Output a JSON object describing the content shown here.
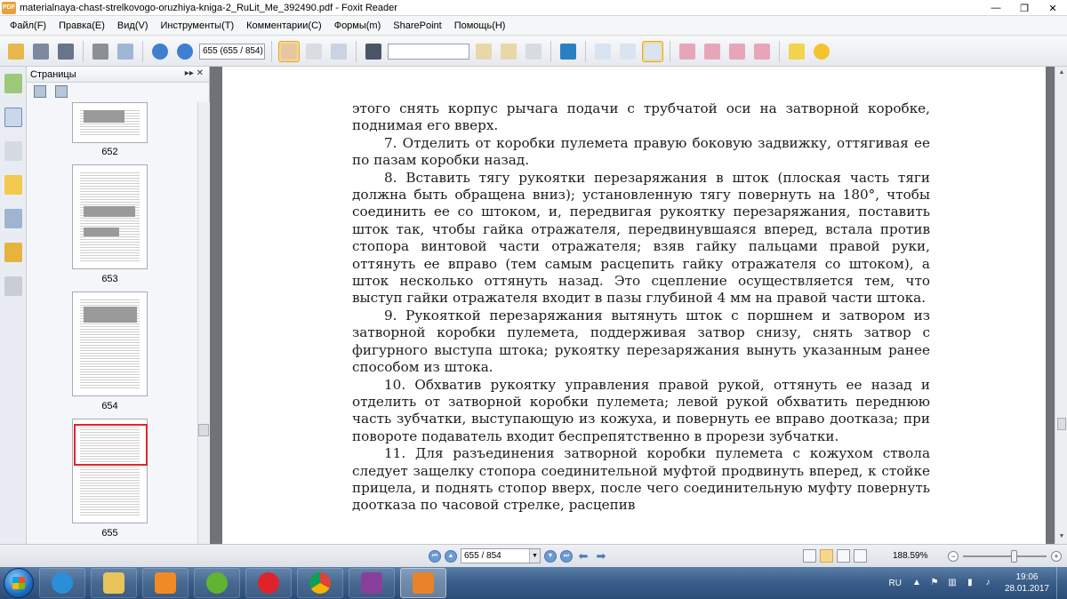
{
  "window": {
    "title": "materialnaya-chast-strelkovogo-oruzhiya-kniga-2_RuLit_Me_392490.pdf - Foxit Reader",
    "app_logo": "PDF",
    "minimize": "—",
    "maximize": "❐",
    "close": "✕"
  },
  "menu": {
    "items": [
      "Файл(F)",
      "Правка(E)",
      "Вид(V)",
      "Инструменты(T)",
      "Комментарии(C)",
      "Формы(m)",
      "SharePoint",
      "Помощь(H)"
    ]
  },
  "toolbar": {
    "page_field": "655 (655 / 854)",
    "search_placeholder": ""
  },
  "sidebar": {
    "title": "Страницы",
    "header_controls": "▸▸  ✕",
    "thumbnails": [
      {
        "label": "652"
      },
      {
        "label": "653"
      },
      {
        "label": "654"
      },
      {
        "label": "655"
      }
    ],
    "selected_page": "655"
  },
  "document": {
    "paragraphs": [
      {
        "text": "этого снять корпус рычага подачи с трубчатой оси на затворной коробке, поднимая его вверх.",
        "indent": false
      },
      {
        "text": "7. Отделить  от коробки пулемета  правую боковую  задвижку, оттягивая ее по пазам коробки назад.",
        "indent": true
      },
      {
        "text": "8. Вставить тягу рукоятки  перезаряжания в шток  (плоская часть тяги должна быть обращена вниз); установленную тягу повернуть на 180°, чтобы соединить ее со штоком, и, передвигая рукоятку перезаряжания, поставить шток так, чтобы гайка отражателя, передвинувшаяся вперед, встала против стопора винтовой части отражателя; взяв гайку пальцами правой руки, оттянуть ее вправо (тем самым расцепить гайку отражателя со штоком), а шток несколько оттянуть назад. Это сцепление осуществляется тем, что выступ гайки отражателя входит в пазы глубиной 4 мм на правой части штока.",
        "indent": true
      },
      {
        "text": "9. Рукояткой перезаряжания вытянуть шток с поршнем и затвором из затворной коробки пулемета, поддерживая затвор снизу, снять затвор с фигурного  выступа штока;  рукоятку перезаряжания  вынуть указанным ранее способом из штока.",
        "indent": true
      },
      {
        "text": "10. Обхватив рукоятку управления правой рукой, оттянуть ее назад и отделить от затворной коробки пулемета; левой рукой обхватить переднюю часть зубчатки, выступающую из кожуха, и повернуть ее вправо доотказа; при повороте подаватель входит беспрепятственно в прорези зубчатки.",
        "indent": true
      },
      {
        "text": "11. Для разъединения  затворной  коробки пулемета  с кожухом ствола следует защелку стопора  соединительной муфтой  продвинуть вперед, к стойке прицела, и поднять стопор вверх, после чего соединительную муфту  повернуть доотказа по  часовой стрелке,  расцепив",
        "indent": true
      }
    ]
  },
  "statusbar": {
    "page_field": "655 / 854",
    "zoom": "188.59%",
    "zoom_level_fraction": 0.48
  },
  "taskbar": {
    "apps": [
      {
        "name": "internet-explorer",
        "color": "#2a8fd8"
      },
      {
        "name": "file-explorer",
        "color": "#e8c45a"
      },
      {
        "name": "media-player",
        "color": "#f08a24"
      },
      {
        "name": "utorrent",
        "color": "#5fb532"
      },
      {
        "name": "opera",
        "color": "#e0232b"
      },
      {
        "name": "chrome",
        "color": "#3c9a4a"
      },
      {
        "name": "winrar",
        "color": "#8a3f9c"
      },
      {
        "name": "foxit-reader",
        "color": "#e8832a"
      }
    ],
    "tray_language": "RU",
    "time": "19:06",
    "date": "28.01.2017"
  },
  "colors": {
    "accent_selected": "#f3d98e",
    "thumbnail_selection": "#e0262c",
    "taskbar": "#2a4d78",
    "document_bg": "#6f7378"
  }
}
